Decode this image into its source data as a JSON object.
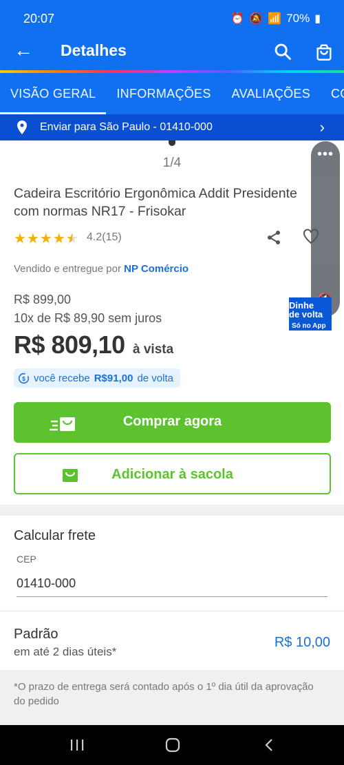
{
  "status": {
    "time": "20:07",
    "battery": "70%"
  },
  "header": {
    "title": "Detalhes"
  },
  "tabs": [
    {
      "label": "VISÃO GERAL"
    },
    {
      "label": "INFORMAÇÕES"
    },
    {
      "label": "AVALIAÇÕES"
    },
    {
      "label": "COM"
    }
  ],
  "shipping_bar": {
    "label": "Enviar para São Paulo - 01410-000"
  },
  "gallery": {
    "counter": "1/4"
  },
  "product": {
    "name_line1": "Cadeira Escritório Ergonômica Addit Presidente",
    "name_line2": "com normas NR17 - Frisokar",
    "rating": "4.2(15)",
    "rating_value": 4.2,
    "seller_prefix": "Vendido e entregue por",
    "seller_name": "NP Comércio",
    "old_price": "R$ 899,00",
    "installments": "10x de R$ 89,90 sem juros",
    "price": "R$ 809,10",
    "price_suffix": "à vista",
    "cashback_prefix": "você recebe",
    "cashback_value": "R$91,00",
    "cashback_suffix": "de volta"
  },
  "cashback_badge": {
    "line1": "Dinhe",
    "line2": "de volta",
    "line3": "Só no App"
  },
  "actions": {
    "buy_label": "Comprar agora",
    "add_label": "Adicionar à sacola"
  },
  "freight": {
    "title": "Calcular frete",
    "cep_label": "CEP",
    "cep_value": "01410-000",
    "option_title": "Padrão",
    "option_sub": "em até 2 dias úteis*",
    "option_price": "R$ 10,00",
    "note": "*O prazo de entrega será contado após o 1º dia útil da aprovação do pedido"
  },
  "colors": {
    "primary": "#1070f0",
    "green": "#5cc32e",
    "link": "#1a6fd6",
    "star": "#f2b100"
  }
}
